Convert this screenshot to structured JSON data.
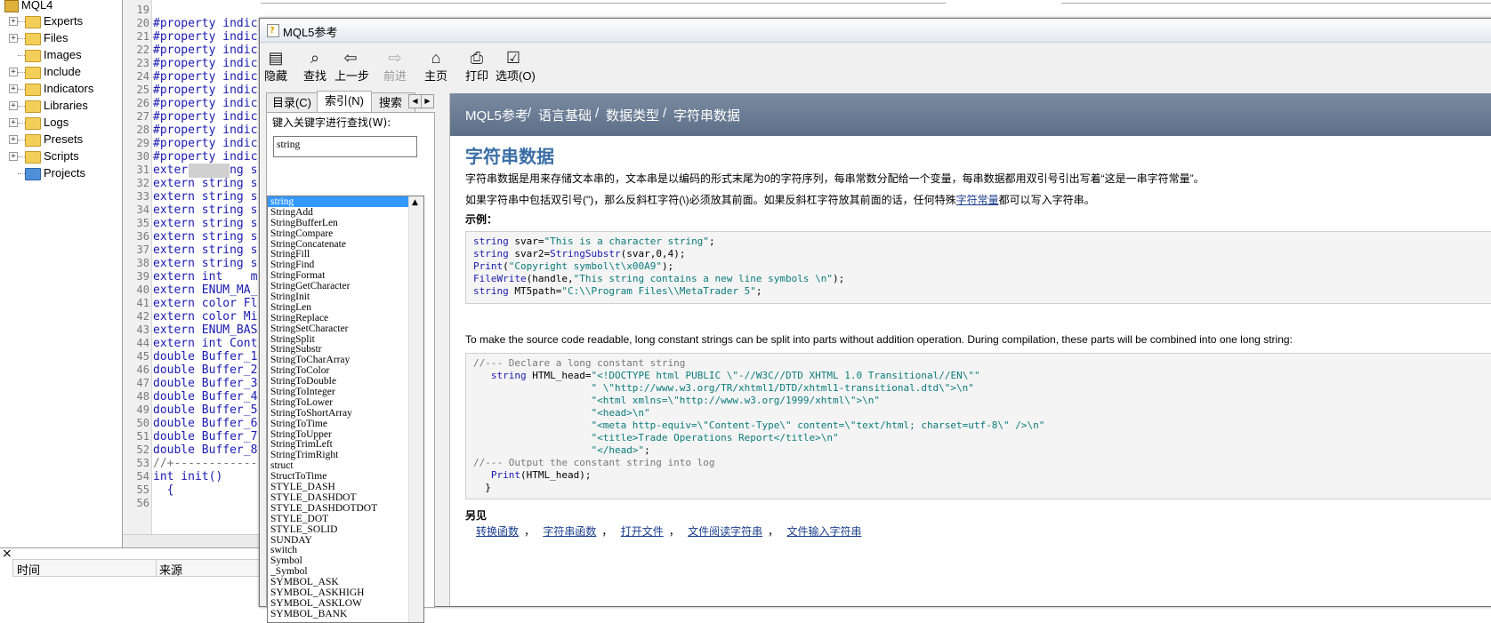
{
  "navigator": {
    "root_label": "MQL4",
    "items": [
      {
        "label": "Experts",
        "expandable": true
      },
      {
        "label": "Files",
        "expandable": true
      },
      {
        "label": "Images",
        "expandable": false
      },
      {
        "label": "Include",
        "expandable": true
      },
      {
        "label": "Indicators",
        "expandable": true
      },
      {
        "label": "Libraries",
        "expandable": true
      },
      {
        "label": "Logs",
        "expandable": true
      },
      {
        "label": "Presets",
        "expandable": true
      },
      {
        "label": "Scripts",
        "expandable": true
      },
      {
        "label": "Projects",
        "expandable": false
      }
    ]
  },
  "editor": {
    "lines": [
      {
        "n": "19",
        "t": ""
      },
      {
        "n": "20",
        "t": "#property indic"
      },
      {
        "n": "21",
        "t": "#property indic"
      },
      {
        "n": "22",
        "t": "#property indic"
      },
      {
        "n": "23",
        "t": "#property indic"
      },
      {
        "n": "24",
        "t": "#property indic"
      },
      {
        "n": "25",
        "t": "#property indic"
      },
      {
        "n": "26",
        "t": "#property indic"
      },
      {
        "n": "27",
        "t": "#property indic"
      },
      {
        "n": "28",
        "t": "#property indic"
      },
      {
        "n": "29",
        "t": "#property indic"
      },
      {
        "n": "30",
        "t": "#property indic"
      },
      {
        "n": "31",
        "t": "extern string s"
      },
      {
        "n": "32",
        "t": "extern string s"
      },
      {
        "n": "33",
        "t": "extern string s"
      },
      {
        "n": "34",
        "t": "extern string s"
      },
      {
        "n": "35",
        "t": "extern string s"
      },
      {
        "n": "36",
        "t": "extern string s"
      },
      {
        "n": "37",
        "t": "extern string s"
      },
      {
        "n": "38",
        "t": "extern string s"
      },
      {
        "n": "39",
        "t": "extern int    m"
      },
      {
        "n": "40",
        "t": "extern ENUM_MA_"
      },
      {
        "n": "41",
        "t": "extern color Fl"
      },
      {
        "n": "42",
        "t": "extern color Mi"
      },
      {
        "n": "43",
        "t": "extern ENUM_BAS"
      },
      {
        "n": "44",
        "t": "extern int Cont"
      },
      {
        "n": "45",
        "t": "double Buffer_1"
      },
      {
        "n": "46",
        "t": "double Buffer_2"
      },
      {
        "n": "47",
        "t": "double Buffer_3"
      },
      {
        "n": "48",
        "t": "double Buffer_4"
      },
      {
        "n": "49",
        "t": "double Buffer_5"
      },
      {
        "n": "50",
        "t": "double Buffer_6"
      },
      {
        "n": "51",
        "t": "double Buffer_7"
      },
      {
        "n": "52",
        "t": "double Buffer_8"
      },
      {
        "n": "53",
        "t": "//+------------"
      },
      {
        "n": "54",
        "t": "int init()"
      },
      {
        "n": "55",
        "t": "  {"
      },
      {
        "n": "56",
        "t": ""
      }
    ]
  },
  "toolbox": {
    "close_glyph": "×",
    "col_time": "时间",
    "col_source": "来源"
  },
  "help": {
    "title": "MQL5参考",
    "toolbar": [
      {
        "label": "隐藏",
        "icon": "hide-icon"
      },
      {
        "label": "查找",
        "icon": "find-icon"
      },
      {
        "label": "上一步",
        "icon": "back-icon"
      },
      {
        "label": "前进",
        "icon": "forward-icon"
      },
      {
        "label": "主页",
        "icon": "home-icon"
      },
      {
        "label": "打印",
        "icon": "print-icon"
      },
      {
        "label": "选项(O)",
        "icon": "options-icon"
      }
    ],
    "tabs": [
      "目录(C)",
      "索引(N)",
      "搜索"
    ],
    "keyword_label": "键入关键字进行查找(W):",
    "keyword_value": "string",
    "index_items": [
      "string",
      "StringAdd",
      "StringBufferLen",
      "StringCompare",
      "StringConcatenate",
      "StringFill",
      "StringFind",
      "StringFormat",
      "StringGetCharacter",
      "StringInit",
      "StringLen",
      "StringReplace",
      "StringSetCharacter",
      "StringSplit",
      "StringSubstr",
      "StringToCharArray",
      "StringToColor",
      "StringToDouble",
      "StringToInteger",
      "StringToLower",
      "StringToShortArray",
      "StringToTime",
      "StringToUpper",
      "StringTrimLeft",
      "StringTrimRight",
      "struct",
      "StructToTime",
      "STYLE_DASH",
      "STYLE_DASHDOT",
      "STYLE_DASHDOTDOT",
      "STYLE_DOT",
      "STYLE_SOLID",
      "SUNDAY",
      "switch",
      "Symbol",
      "_Symbol",
      "SYMBOL_ASK",
      "SYMBOL_ASKHIGH",
      "SYMBOL_ASKLOW",
      "SYMBOL_BANK"
    ],
    "breadcrumb": [
      "MQL5参考",
      "语言基础",
      "数据类型",
      "字符串数据"
    ],
    "breadcrumb_sep": "/",
    "page_title": "字符串数据",
    "para1": "字符串数据是用来存储文本串的，文本串是以编码的形式末尾为0的字符序列，每串常数分配给一个变量，每串数据都用双引号引出写着“这是一串字符常量”。",
    "para2_a": "如果字符串中包括双引号(\")，那么反斜杠字符(\\)必须放其前面。如果反斜杠字符放其前面的话，任何特殊",
    "para2_link": "字符常量",
    "para2_b": "都可以写入字符串。",
    "example_label": "示例：",
    "para3": "To make the source code readable, long constant strings can be split into parts without addition operation. During compilation, these parts will be combined into one long string:",
    "see_also_label": "另见",
    "see_also": [
      "转换函数",
      "字符串函数",
      "打开文件",
      "文件阅读字符串",
      "文件输入字符串"
    ]
  }
}
